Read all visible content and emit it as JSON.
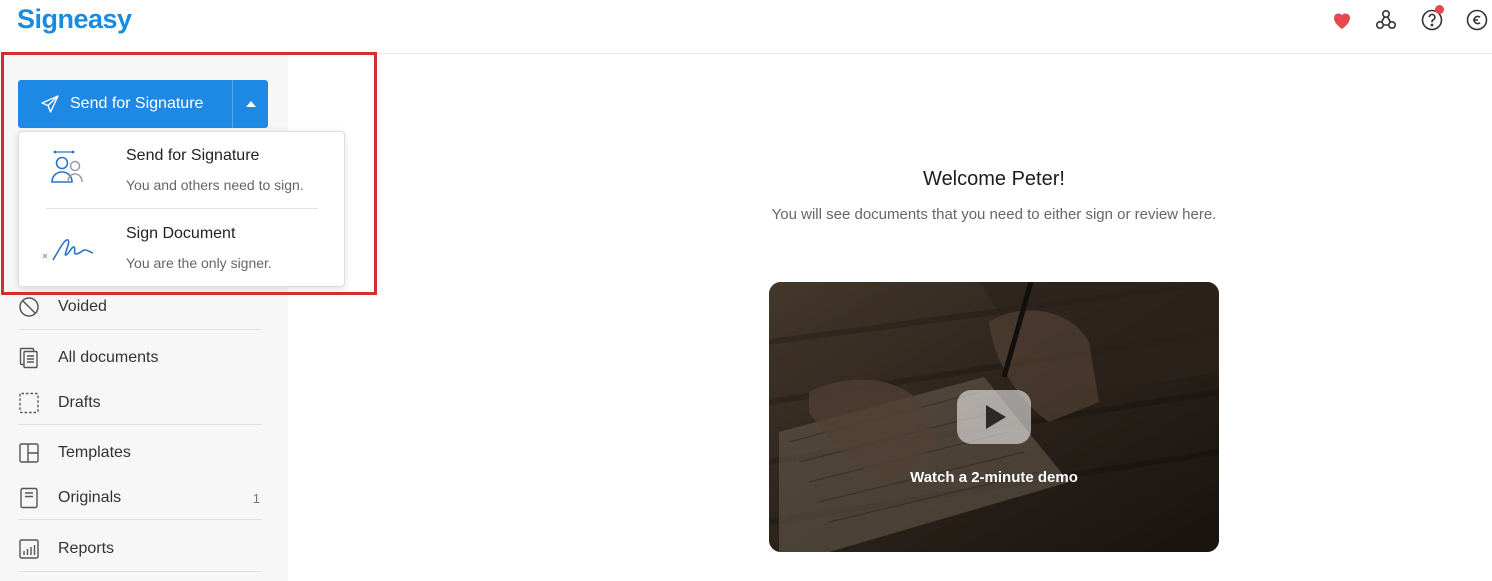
{
  "header": {
    "logo": "Signeasy",
    "icons": [
      "heart-icon",
      "integrations-icon",
      "help-icon",
      "credits-icon"
    ],
    "accent_color": "#1a8ce0",
    "heart_color": "#e5484d"
  },
  "send_button": {
    "label": "Send for Signature",
    "color": "#1e88e5"
  },
  "dropdown": {
    "items": [
      {
        "title": "Send for Signature",
        "desc": "You and others need to sign.",
        "icon": "signers-icon"
      },
      {
        "title": "Sign Document",
        "desc": "You are the only signer.",
        "icon": "signature-icon"
      }
    ]
  },
  "sidebar": {
    "items": [
      {
        "label": "Voided",
        "icon": "voided-icon",
        "count": ""
      },
      {
        "label": "All documents",
        "icon": "all-documents-icon",
        "count": ""
      },
      {
        "label": "Drafts",
        "icon": "drafts-icon",
        "count": ""
      },
      {
        "label": "Templates",
        "icon": "templates-icon",
        "count": ""
      },
      {
        "label": "Originals",
        "icon": "originals-icon",
        "count": "1"
      },
      {
        "label": "Reports",
        "icon": "reports-icon",
        "count": ""
      }
    ]
  },
  "main": {
    "welcome_title": "Welcome Peter!",
    "welcome_subtitle": "You will see documents that you need to either sign or review here.",
    "video_caption": "Watch a 2-minute demo"
  },
  "highlight_color": "#d32f2f"
}
